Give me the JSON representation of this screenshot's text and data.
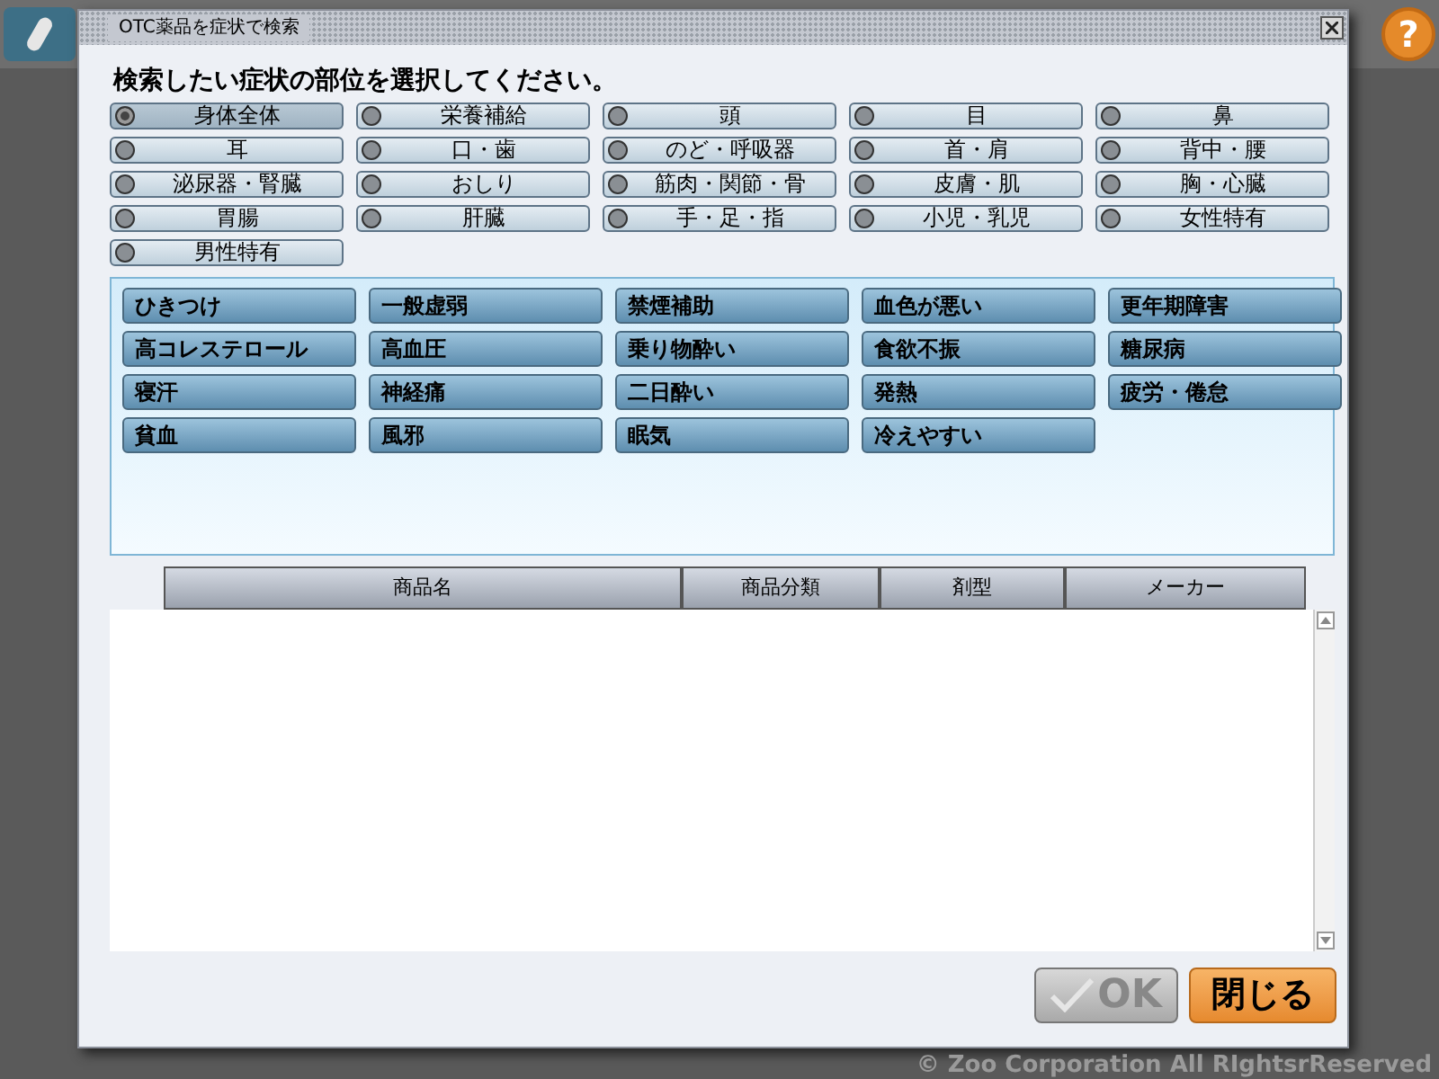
{
  "window": {
    "title": "OTC薬品を症状で検索"
  },
  "background": {
    "help_label": "?"
  },
  "heading": "検索したい症状の部位を選択してください。",
  "regions": [
    {
      "label": "身体全体",
      "selected": true
    },
    {
      "label": "栄養補給",
      "selected": false
    },
    {
      "label": "頭",
      "selected": false
    },
    {
      "label": "目",
      "selected": false
    },
    {
      "label": "鼻",
      "selected": false
    },
    {
      "label": "耳",
      "selected": false
    },
    {
      "label": "口・歯",
      "selected": false
    },
    {
      "label": "のど・呼吸器",
      "selected": false
    },
    {
      "label": "首・肩",
      "selected": false
    },
    {
      "label": "背中・腰",
      "selected": false
    },
    {
      "label": "泌尿器・腎臓",
      "selected": false
    },
    {
      "label": "おしり",
      "selected": false
    },
    {
      "label": "筋肉・関節・骨",
      "selected": false
    },
    {
      "label": "皮膚・肌",
      "selected": false
    },
    {
      "label": "胸・心臓",
      "selected": false
    },
    {
      "label": "胃腸",
      "selected": false
    },
    {
      "label": "肝臓",
      "selected": false
    },
    {
      "label": "手・足・指",
      "selected": false
    },
    {
      "label": "小児・乳児",
      "selected": false
    },
    {
      "label": "女性特有",
      "selected": false
    },
    {
      "label": "男性特有",
      "selected": false
    }
  ],
  "symptoms": [
    "ひきつけ",
    "一般虚弱",
    "禁煙補助",
    "血色が悪い",
    "更年期障害",
    "高コレステロール",
    "高血圧",
    "乗り物酔い",
    "食欲不振",
    "糖尿病",
    "寝汗",
    "神経痛",
    "二日酔い",
    "発熱",
    "疲労・倦怠",
    "貧血",
    "風邪",
    "眠気",
    "冷えやすい"
  ],
  "table": {
    "columns": [
      "商品名",
      "商品分類",
      "剤型",
      "メーカー"
    ]
  },
  "buttons": [
    {
      "kind": "ok",
      "label": "OK",
      "disabled": true
    },
    {
      "kind": "close",
      "label": "閉じる",
      "disabled": false
    }
  ],
  "copyright": "© Zoo Corporation All RIghtsrReserved"
}
